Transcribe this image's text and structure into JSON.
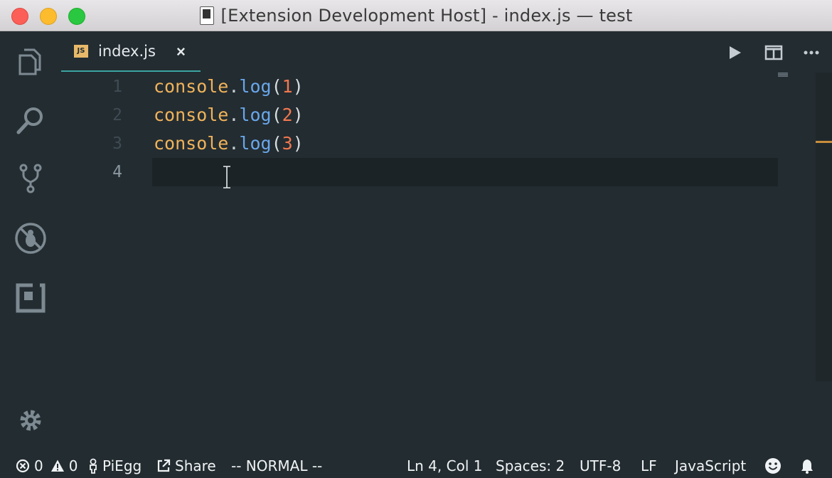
{
  "window": {
    "title": "[Extension Development Host] - index.js — test"
  },
  "activity_bar": {
    "items": [
      {
        "icon": "files-icon"
      },
      {
        "icon": "search-icon"
      },
      {
        "icon": "source-control-icon"
      },
      {
        "icon": "debug-icon"
      },
      {
        "icon": "extensions-icon"
      }
    ],
    "bottom": {
      "icon": "gear-icon"
    }
  },
  "tabs": [
    {
      "label": "index.js",
      "badge": "JS",
      "close": "×",
      "active": true
    }
  ],
  "editor": {
    "lines": [
      {
        "number": "1",
        "obj": "console",
        "dot": ".",
        "fn": "log",
        "open": "(",
        "arg": "1",
        "close": ")"
      },
      {
        "number": "2",
        "obj": "console",
        "dot": ".",
        "fn": "log",
        "open": "(",
        "arg": "2",
        "close": ")"
      },
      {
        "number": "3",
        "obj": "console",
        "dot": ".",
        "fn": "log",
        "open": "(",
        "arg": "3",
        "close": ")"
      },
      {
        "number": "4",
        "obj": "",
        "dot": "",
        "fn": "",
        "open": "",
        "arg": "",
        "close": ""
      }
    ],
    "current_line": 4
  },
  "statusbar": {
    "errors": "0",
    "warnings": "0",
    "user": "PiEgg",
    "share": "Share",
    "mode": "-- NORMAL --",
    "position": "Ln 4, Col 1",
    "spaces": "Spaces: 2",
    "encoding": "UTF-8",
    "eol": "LF",
    "language": "JavaScript"
  },
  "colors": {
    "background": "#232c31",
    "accent": "#3aa4a0",
    "keyword": "#f0b35a",
    "function": "#69a7ea",
    "number": "#f0784f"
  }
}
